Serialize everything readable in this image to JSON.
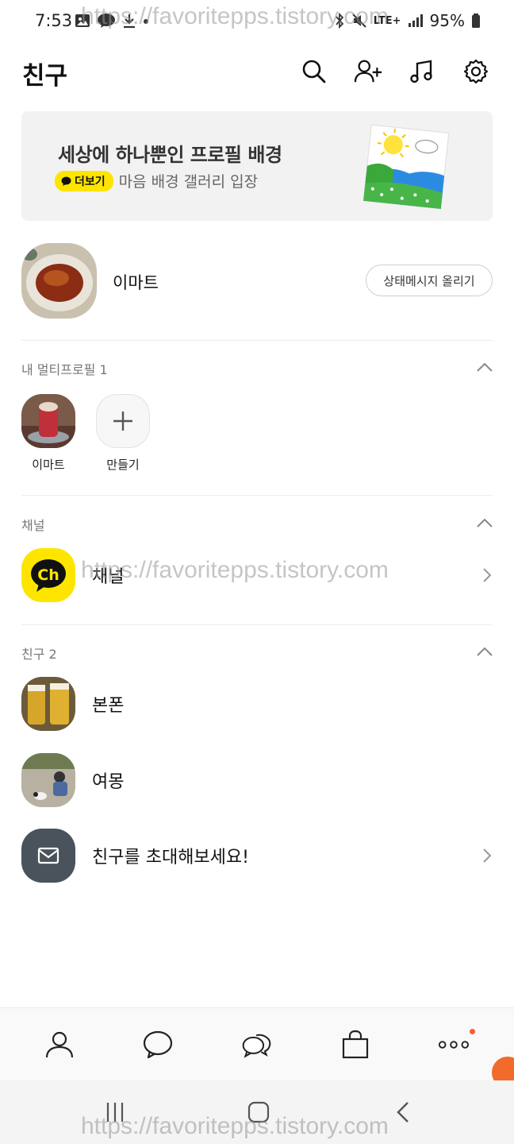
{
  "status_bar": {
    "time": "7:53",
    "network": "LTE+",
    "battery": "95%"
  },
  "header": {
    "title": "친구",
    "icons": [
      "search-icon",
      "add-friend-icon",
      "music-icon",
      "settings-icon"
    ]
  },
  "banner": {
    "title": "세상에 하나뿐인 프로필 배경",
    "badge": "더보기",
    "subtitle": "마음 배경 갤러리 입장"
  },
  "my_profile": {
    "name": "이마트",
    "status_button": "상태메시지 올리기"
  },
  "multi_profile": {
    "label": "내 멀티프로필 1",
    "items": [
      {
        "label": "이마트"
      },
      {
        "label": "만들기"
      }
    ]
  },
  "channel": {
    "label": "채널",
    "item": "채널",
    "logo_text": "Ch"
  },
  "friends": {
    "label": "친구 2",
    "items": [
      {
        "name": "본폰"
      },
      {
        "name": "여몽"
      }
    ],
    "invite": "친구를 초대해보세요!"
  },
  "watermark": "https://favoritepps.tistory.com",
  "colors": {
    "kakao_yellow": "#fee500",
    "banner_bg": "#f2f2f2",
    "invite_icon_bg": "#4a525c",
    "notification_dot": "#ff5a36"
  }
}
